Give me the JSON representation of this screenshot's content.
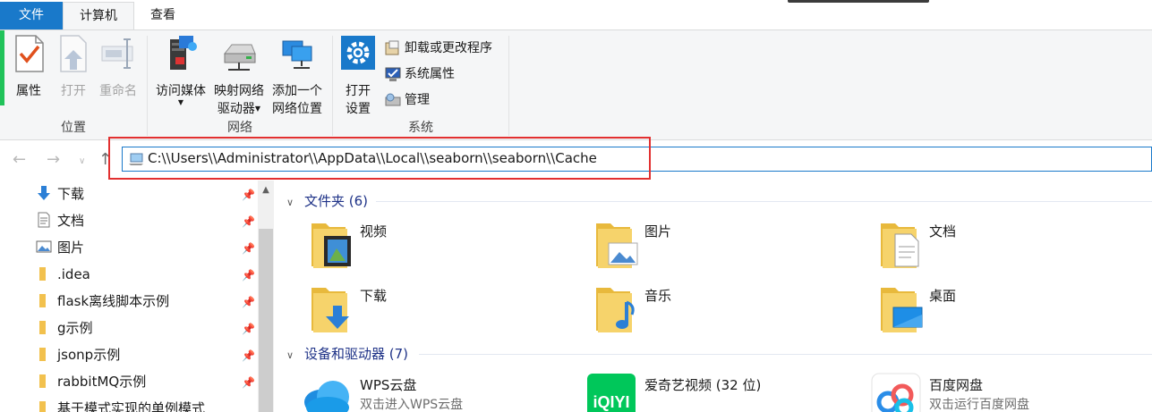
{
  "tabs": {
    "file": "文件",
    "computer": "计算机",
    "view": "查看"
  },
  "ribbon": {
    "location_group": {
      "title": "位置",
      "properties": "属性",
      "open": "打开",
      "rename": "重命名"
    },
    "network_group": {
      "title": "网络",
      "access_media": "访问媒体",
      "map_drive_line1": "映射网络",
      "map_drive_line2": "驱动器",
      "add_location_line1": "添加一个",
      "add_location_line2": "网络位置"
    },
    "system_group": {
      "title": "系统",
      "open_settings_line1": "打开",
      "open_settings_line2": "设置",
      "uninstall": "卸载或更改程序",
      "system_properties": "系统属性",
      "manage": "管理"
    }
  },
  "address": {
    "path": "C:\\\\Users\\\\Administrator\\\\AppData\\\\Local\\\\seaborn\\\\seaborn\\\\Cache"
  },
  "navpane": {
    "items": [
      {
        "label": "下载",
        "icon": "download-arrow-icon"
      },
      {
        "label": "文档",
        "icon": "document-icon"
      },
      {
        "label": "图片",
        "icon": "picture-icon"
      },
      {
        "label": ".idea",
        "icon": "folder-icon"
      },
      {
        "label": "flask离线脚本示例",
        "icon": "folder-icon"
      },
      {
        "label": "g示例",
        "icon": "folder-icon"
      },
      {
        "label": "jsonp示例",
        "icon": "folder-icon"
      },
      {
        "label": "rabbitMQ示例",
        "icon": "folder-icon"
      },
      {
        "label": "基于模式实现的单例模式",
        "icon": "folder-icon"
      }
    ]
  },
  "content": {
    "folders_header": "文件夹 (6)",
    "folders": [
      {
        "label": "视频"
      },
      {
        "label": "图片"
      },
      {
        "label": "文档"
      },
      {
        "label": "下载"
      },
      {
        "label": "音乐"
      },
      {
        "label": "桌面"
      }
    ],
    "devices_header": "设备和驱动器 (7)",
    "devices": [
      {
        "name": "WPS云盘",
        "sub": "双击进入WPS云盘"
      },
      {
        "name": "爱奇艺视频 (32 位)",
        "sub": ""
      },
      {
        "name": "百度网盘",
        "sub": "双击运行百度网盘"
      }
    ]
  },
  "colors": {
    "accent": "#1979ca",
    "highlight_frame": "#e23030",
    "section_header": "#1e3287"
  }
}
